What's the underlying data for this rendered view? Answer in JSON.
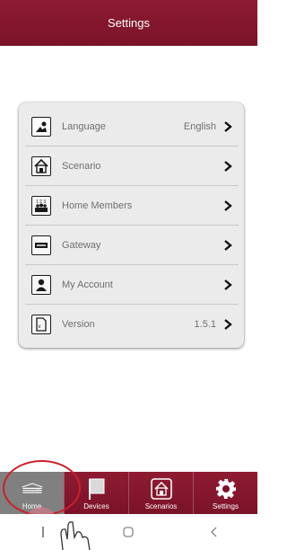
{
  "header": {
    "title": "Settings"
  },
  "settings": {
    "items": [
      {
        "label": "Language",
        "value": "English",
        "icon": "language-icon"
      },
      {
        "label": "Scenario",
        "value": "",
        "icon": "scenario-icon"
      },
      {
        "label": "Home Members",
        "value": "",
        "icon": "home-members-icon"
      },
      {
        "label": "Gateway",
        "value": "",
        "icon": "gateway-icon"
      },
      {
        "label": "My Account",
        "value": "",
        "icon": "account-icon"
      },
      {
        "label": "Version",
        "value": "1.5.1",
        "icon": "version-icon"
      }
    ]
  },
  "tabbar": {
    "tabs": [
      {
        "label": "Home",
        "icon": "home-icon",
        "active": true
      },
      {
        "label": "Devices",
        "icon": "devices-icon",
        "active": false
      },
      {
        "label": "Scenarios",
        "icon": "scenarios-icon",
        "active": false
      },
      {
        "label": "Settings",
        "icon": "gear-icon",
        "active": false
      }
    ]
  },
  "navbar": {
    "icons": [
      "recents-icon",
      "home-circle-icon",
      "back-icon"
    ]
  },
  "colors": {
    "brand": "#7a1228",
    "active_tab": "#808080",
    "highlight": "#cc1f2a"
  }
}
